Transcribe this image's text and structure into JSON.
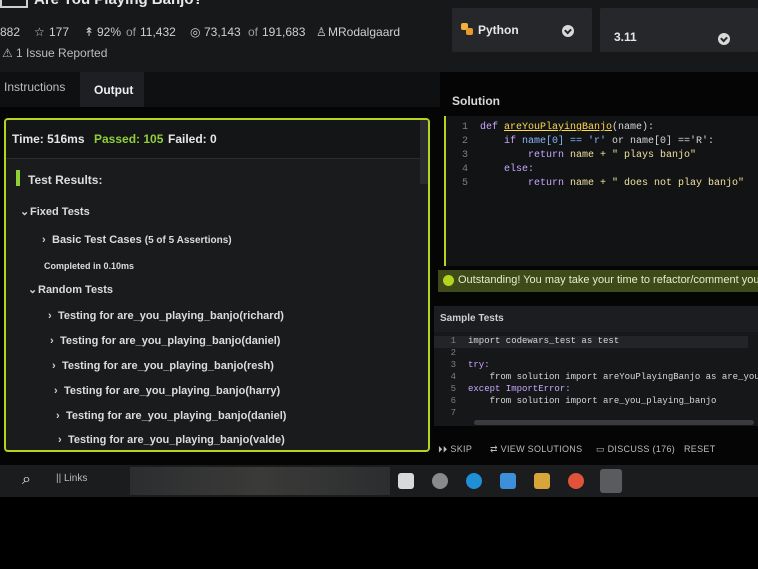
{
  "header": {
    "title": "Are You Playing Banjo?",
    "rank_partial": "882",
    "stars": "177",
    "satisfaction_pct": "92%",
    "satisfaction_of": "of",
    "satisfaction_total": "11,432",
    "completed": "73,143",
    "completed_of": "of",
    "completed_total": "191,683",
    "author": "MRodalgaard",
    "issues": "1 Issue Reported"
  },
  "language": {
    "name": "Python",
    "version": "3.11"
  },
  "tabs": [
    "Instructions",
    "Output"
  ],
  "output": {
    "time": "Time: 516ms",
    "passed": "Passed: 105",
    "failed": "Failed: 0",
    "results_heading": "Test Results:",
    "fixed_tests": "Fixed Tests",
    "basic_cases": "Basic Test Cases",
    "basic_assertions": "(5 of 5 Assertions)",
    "completed_in": "Completed in 0.10ms",
    "random_tests": "Random Tests",
    "random_items": [
      "Testing for are_you_playing_banjo(richard)",
      "Testing for are_you_playing_banjo(daniel)",
      "Testing for are_you_playing_banjo(resh)",
      "Testing for are_you_playing_banjo(harry)",
      "Testing for are_you_playing_banjo(daniel)",
      "Testing for are_you_playing_banjo(valde)"
    ]
  },
  "solution": {
    "label": "Solution",
    "lines": [
      {
        "n": "1",
        "a": "def ",
        "b": "areYouPlayingBanjo",
        "c": "(name):"
      },
      {
        "n": "2",
        "a": "    if ",
        "b": "name[0] == 'r'",
        "c": " or name[0] =='R':"
      },
      {
        "n": "3",
        "a": "        return ",
        "b": "name + \" plays banjo\"",
        "c": ""
      },
      {
        "n": "4",
        "a": "    else:",
        "b": "",
        "c": ""
      },
      {
        "n": "5",
        "a": "        return ",
        "b": "name + \" does not play banjo\"",
        "c": ""
      }
    ]
  },
  "success_message": "Outstanding! You may take your time to refactor/comment you",
  "sample": {
    "label": "Sample Tests",
    "lines": [
      {
        "n": "1",
        "t": "import codewars_test as test"
      },
      {
        "n": "2",
        "t": ""
      },
      {
        "n": "3",
        "t": "try:"
      },
      {
        "n": "4",
        "t": "    from solution import areYouPlayingBanjo as are_you"
      },
      {
        "n": "5",
        "t": "except ImportError:"
      },
      {
        "n": "6",
        "t": "    from solution import are_you_playing_banjo"
      },
      {
        "n": "7",
        "t": ""
      }
    ]
  },
  "actions": {
    "skip": "SKIP",
    "view_solutions": "VIEW SOLUTIONS",
    "discuss": "DISCUSS (176)",
    "reset": "RESET"
  },
  "taskbar": {
    "links": "Links"
  },
  "colors": {
    "accent": "#b6d31d",
    "passed": "#8fcf3a",
    "failed": "#e8e8e8"
  }
}
